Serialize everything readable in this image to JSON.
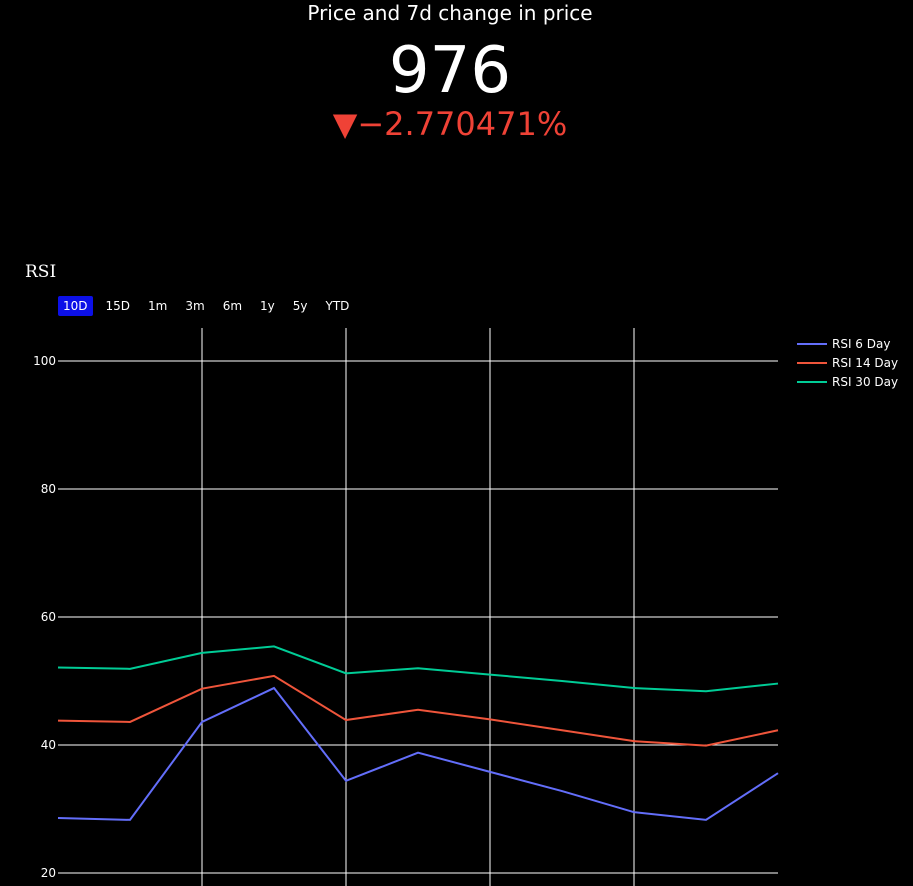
{
  "indicator": {
    "title": "Price and 7d change in price",
    "value": "976",
    "delta": "▼−2.770471%",
    "delta_color": "#ef4236"
  },
  "chart_title": "RSI",
  "range_buttons": [
    "10D",
    "15D",
    "1m",
    "3m",
    "6m",
    "1y",
    "5y",
    "YTD"
  ],
  "active_range": "10D",
  "chart_data": {
    "type": "line",
    "title": "RSI",
    "x": [
      0,
      1,
      2,
      3,
      4,
      5,
      6,
      7,
      8,
      9,
      10
    ],
    "ylim": [
      20,
      105
    ],
    "yticks": [
      20,
      40,
      60,
      80,
      100
    ],
    "grid": true,
    "legend_position": "top-right",
    "series": [
      {
        "name": "RSI 6 Day",
        "color": "#636efa",
        "values": [
          28.6,
          28.3,
          43.6,
          48.9,
          34.4,
          38.8,
          35.8,
          32.8,
          29.5,
          28.3,
          35.6
        ]
      },
      {
        "name": "RSI 14 Day",
        "color": "#ef553b",
        "values": [
          43.8,
          43.6,
          48.8,
          50.8,
          43.9,
          45.5,
          44.0,
          42.3,
          40.6,
          39.9,
          42.3
        ]
      },
      {
        "name": "RSI 30 Day",
        "color": "#00cc96",
        "values": [
          52.1,
          51.9,
          54.4,
          55.4,
          51.2,
          52.0,
          51.0,
          50.0,
          48.9,
          48.4,
          49.6
        ]
      }
    ]
  }
}
